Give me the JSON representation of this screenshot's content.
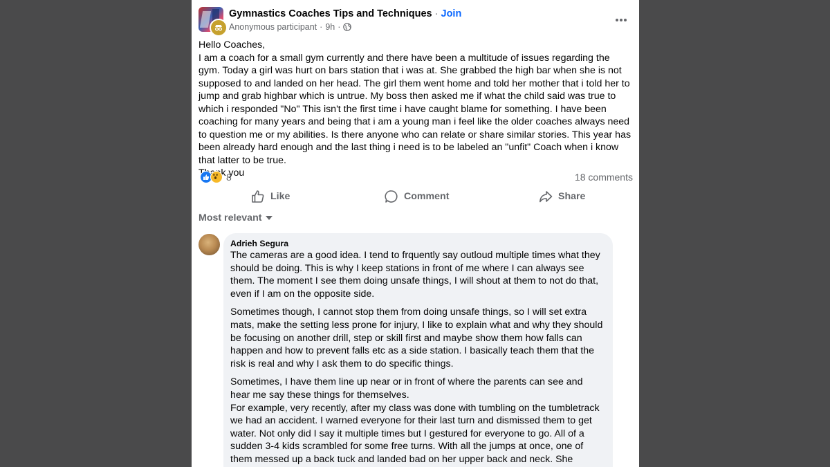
{
  "header": {
    "group_name": "Gymnastics Coaches Tips and Techniques",
    "separator": "·",
    "join_label": "Join",
    "author": "Anonymous participant",
    "time": "9h",
    "privacy_icon": "globe-icon",
    "more_icon": "more-options-icon"
  },
  "post": {
    "greeting": "Hello Coaches,",
    "body": "I am a coach for a small gym currently and there have been a multitude of issues regarding the gym. Today a girl was hurt on bars station that i was at. She grabbed the high bar when she is not supposed to and landed on her head. The girl them went home and told her mother that i told her to jump and grab highbar which is untrue. My boss then asked me if what the child said was true to which i responded \"No\" This isn't the first time i have caught blame for something. I have been coaching for many years and being that i am a young man i feel like the older coaches always need to question me or my abilities. Is there anyone who can relate or share similar stories. This year has been already hard enough and the last thing i need is to be labeled an \"unfit\" Coach when i know that latter to be true.",
    "closing": "Thank you"
  },
  "reactions": {
    "count": "8",
    "comments": "18 comments",
    "types": [
      "like",
      "wow"
    ]
  },
  "actions": {
    "like": "Like",
    "comment": "Comment",
    "share": "Share"
  },
  "sort_label": "Most relevant",
  "comment": {
    "author": "Adrieh Segura",
    "p1": "The cameras are a good idea. I tend to frquently say outloud multiple times what they should be doing. This is why I keep stations in front of me where I can always see them. The moment I see them doing unsafe things, I will shout at them to not do that, even if I am on the opposite side.",
    "p2": "Sometimes though, I cannot stop them from doing unsafe things, so I will set extra mats, make the setting less prone for injury, I like to explain what and why they should be focusing on another drill, step or skill first and maybe show them how falls can happen and how to prevent falls etc as a side station. I basically teach them that the risk is real and why I ask them to do specific things.",
    "p3": "Sometimes, I have them line up near or in front of where the parents can see and hear me say these things for themselves.",
    "p4": "For example, very recently, after my class was done with tumbling on the tumbletrack we had an accident. I warned everyone for their last turn and dismissed them to get water. Not only did I say it multiple times but I gestured for everyone to go. All of a sudden 3-4 kids scrambled for some free turns. With all the jumps at once, one of them messed up a back tuck and landed bad on her upper back and neck. She squashed"
  },
  "colors": {
    "background": "#4a4a4b",
    "card": "#ffffff",
    "accent": "#0866ff",
    "secondary_text": "#65676b",
    "bubble": "#f0f2f5"
  }
}
